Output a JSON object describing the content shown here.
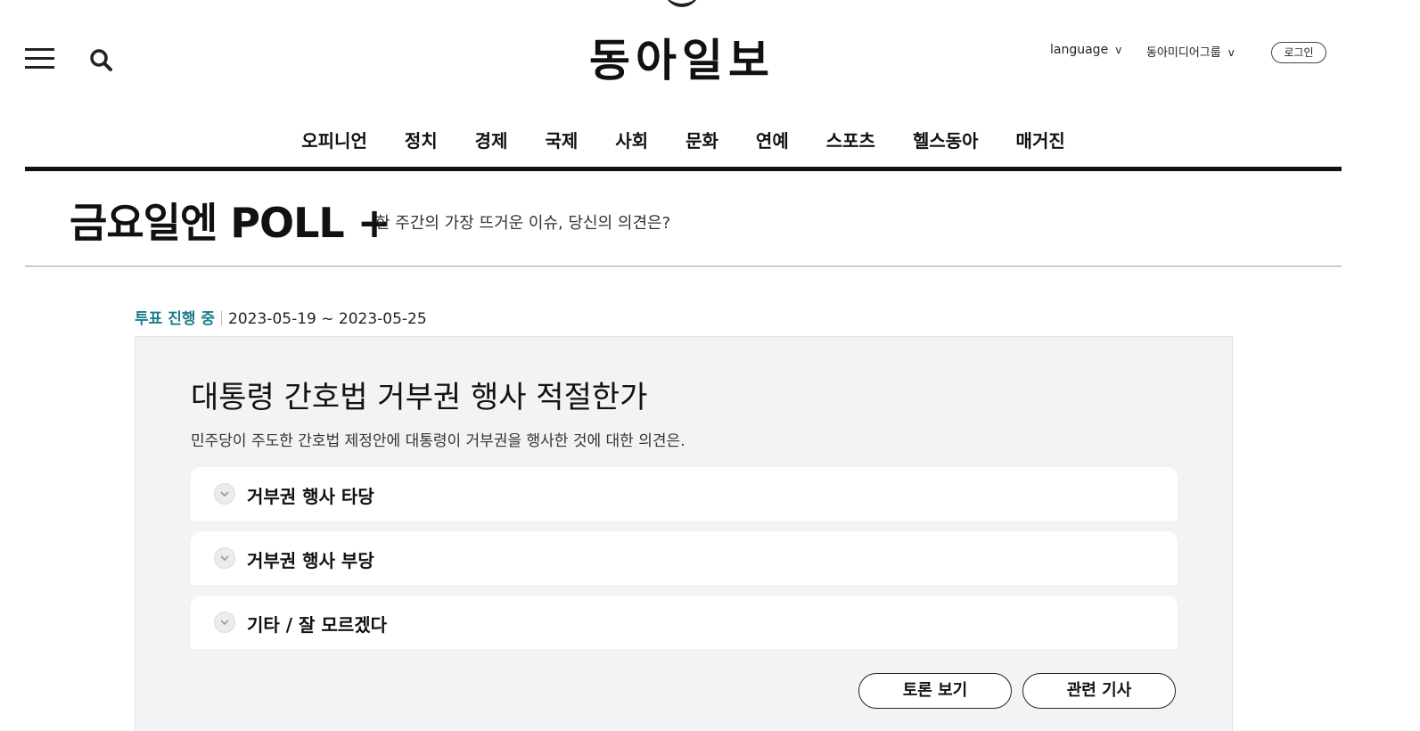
{
  "header": {
    "logo_text": "동아일보",
    "language_label": "language",
    "group_label": "동아미디어그룹",
    "chevron": "v",
    "login_label": "로그인"
  },
  "nav": {
    "items": [
      {
        "label": "오피니언"
      },
      {
        "label": "정치"
      },
      {
        "label": "경제"
      },
      {
        "label": "국제"
      },
      {
        "label": "사회"
      },
      {
        "label": "문화"
      },
      {
        "label": "연예"
      },
      {
        "label": "스포츠"
      },
      {
        "label": "헬스동아"
      },
      {
        "label": "매거진"
      }
    ]
  },
  "poll_header": {
    "title": "금요일엔 POLL +",
    "subtitle": "한 주간의 가장 뜨거운 이슈, 당신의 의견은?"
  },
  "poll": {
    "status": "투표 진행 중",
    "period": "2023-05-19 ~ 2023-05-25",
    "question": "대통령 간호법 거부권 행사 적절한가",
    "description": "민주당이 주도한 간호법 제정안에 대통령이 거부권을 행사한 것에 대한 의견은.",
    "options": [
      {
        "label": "거부권 행사 타당"
      },
      {
        "label": "거부권 행사 부당"
      },
      {
        "label": "기타 / 잘 모르겠다"
      }
    ],
    "debate_button": "토론 보기",
    "related_button": "관련 기사"
  },
  "colors": {
    "accent": "#1a7f8e",
    "card_bg": "#f2f3f5"
  },
  "icons": [
    "menu-icon",
    "search-icon",
    "check-icon"
  ]
}
